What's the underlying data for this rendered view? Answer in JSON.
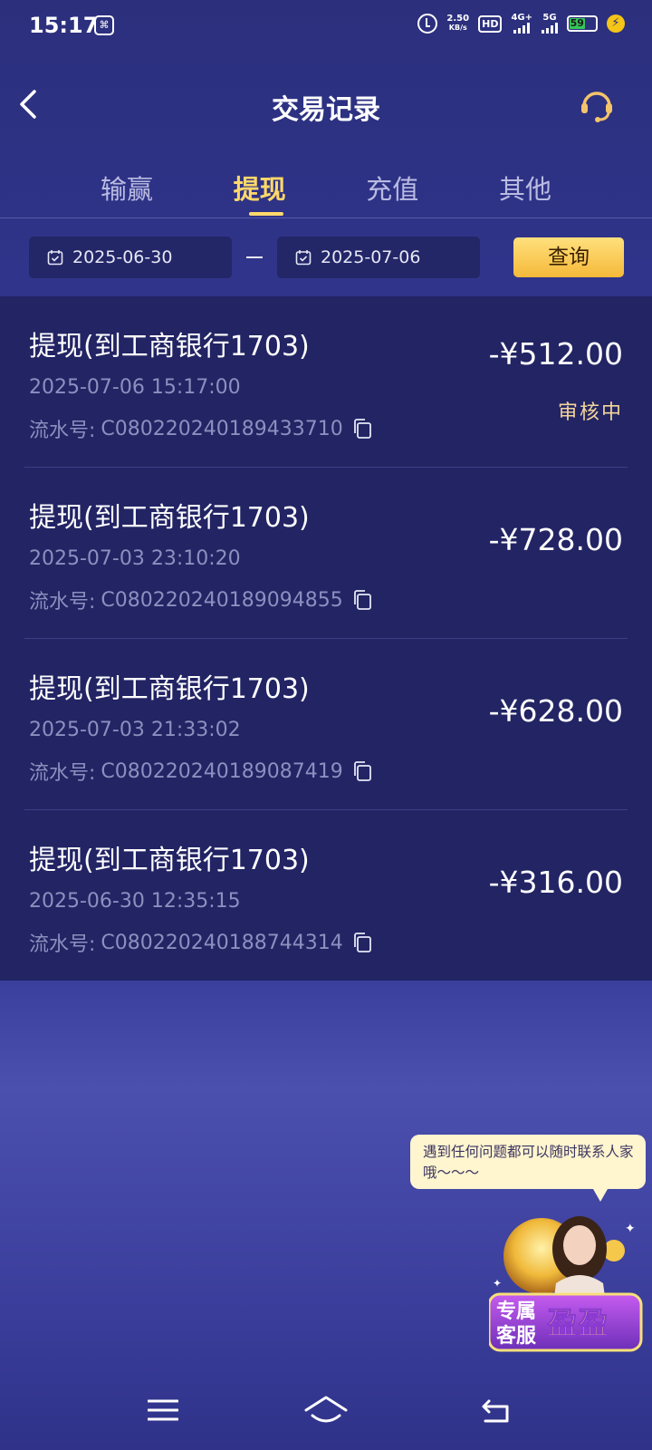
{
  "status_bar": {
    "time": "15:17",
    "net_speed_value": "2.50",
    "net_speed_unit": "KB/s",
    "hd_label": "HD",
    "network_label": "4G+",
    "network_label_2": "5G",
    "battery_level": "59"
  },
  "header": {
    "title": "交易记录",
    "back_icon": "chevron-left-icon",
    "service_icon": "headset-icon"
  },
  "tabs": [
    {
      "label": "输赢",
      "active": false
    },
    {
      "label": "提现",
      "active": true
    },
    {
      "label": "充值",
      "active": false
    },
    {
      "label": "其他",
      "active": false
    }
  ],
  "filter": {
    "start_date": "2025-06-30",
    "end_date": "2025-07-06",
    "query_label": "查询"
  },
  "records": [
    {
      "title": "提现(到工商银行1703)",
      "time": "2025-07-06 15:17:00",
      "serial_label": "流水号:",
      "serial": "C080220240189433710",
      "amount": "-¥512.00",
      "status": "审核中"
    },
    {
      "title": "提现(到工商银行1703)",
      "time": "2025-07-03 23:10:20",
      "serial_label": "流水号:",
      "serial": "C080220240189094855",
      "amount": "-¥728.00",
      "status": ""
    },
    {
      "title": "提现(到工商银行1703)",
      "time": "2025-07-03 21:33:02",
      "serial_label": "流水号:",
      "serial": "C080220240189087419",
      "amount": "-¥628.00",
      "status": ""
    },
    {
      "title": "提现(到工商银行1703)",
      "time": "2025-06-30 12:35:15",
      "serial_label": "流水号:",
      "serial": "C080220240188744314",
      "amount": "-¥316.00",
      "status": ""
    }
  ],
  "support": {
    "bubble_text": "遇到任何问题都可以随时联系人家哦～～～",
    "badge_text_1": "专属",
    "badge_text_2": "客服",
    "badge_name": "盈盈"
  },
  "colors": {
    "accent": "#ffd86a",
    "background": "#2b2f7c",
    "list_bg": "#222464",
    "status_pending": "#f3d59a"
  }
}
